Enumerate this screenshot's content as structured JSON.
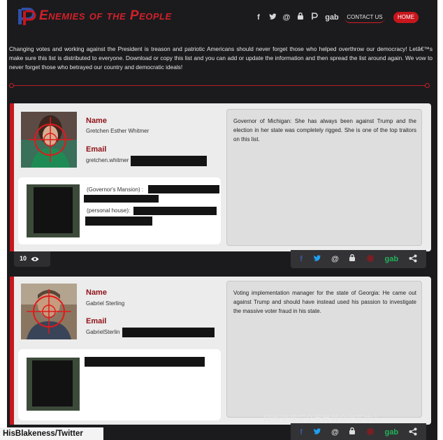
{
  "header": {
    "title": "Enemies of the People",
    "social_icons": [
      "facebook-icon",
      "twitter-icon",
      "at-icon",
      "parler-icon",
      "p-icon",
      "gab-icon"
    ],
    "social_labels": [
      "f",
      "",
      "@",
      "",
      "",
      "gab"
    ],
    "contact_label": "CONTACT US",
    "home_label": "HOME"
  },
  "intro": "Changing votes and working against the President is treason and patriotic Americans should never forget those who helped overthrow our democracy! Letâ€™s make sure this list is distributed to everyone. Download or copy this list and you can add or update the information and then spread the list around again. We vow to never forget those who betrayed our country and democratic ideals!",
  "entries": [
    {
      "name_label": "Name",
      "name": "Gretchen Esther Whitmer",
      "email_label": "Email",
      "email": "gretchen.whitmer",
      "address_1": "(Governor's Mansion) :",
      "address_2": "(personal house):",
      "description": "Governor of Michigan: She has always been against Trump and the election in her state was completely rigged. She is one of the top traitors on this list.",
      "views": "10"
    },
    {
      "name_label": "Name",
      "name": "Gabriel Sterling",
      "email_label": "Email",
      "email": "GabrielSterlin",
      "description": "Voting implementation manager for the state of Georgia: He came out against Trump and should have instead used his passion to investigate the massive voter fraud in his state."
    }
  ],
  "share_labels": [
    "f",
    "",
    "@",
    "",
    "",
    "gab",
    ""
  ],
  "watermark": "网络空间安全军民融合创新中心",
  "credit": "HisBlakeness/Twitter",
  "colors": {
    "accent": "#c8161d",
    "background": "#1b1b1d",
    "card": "#ececec"
  }
}
